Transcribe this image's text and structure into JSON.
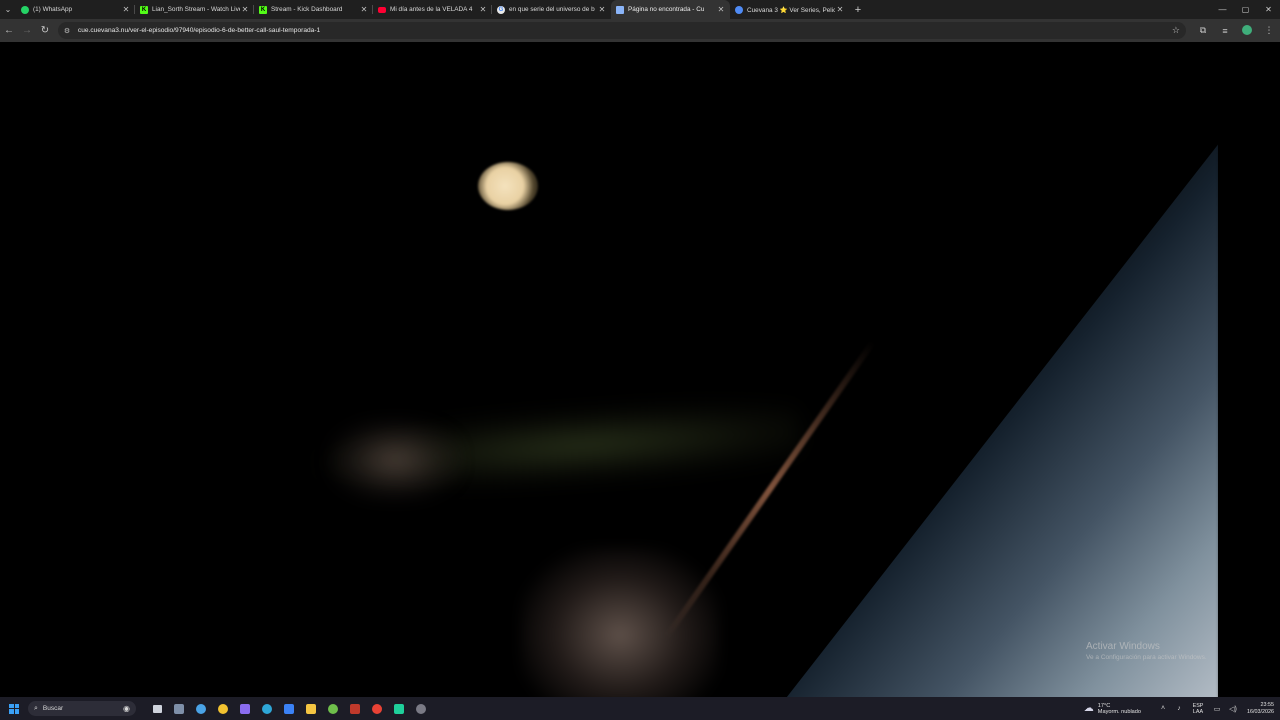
{
  "browser": {
    "tabs": [
      {
        "title": "(1) WhatsApp",
        "icon": "whatsapp-icon",
        "color": "#25d366",
        "active": false
      },
      {
        "title": "Lian_Sorth Stream - Watch Live",
        "icon": "kick-icon",
        "color": "#53fc18",
        "active": false
      },
      {
        "title": "Stream - Kick Dashboard",
        "icon": "kick-icon",
        "color": "#53fc18",
        "active": false
      },
      {
        "title": "Mi día antes de la VELADA 4",
        "icon": "youtube-icon",
        "color": "#ff0033",
        "active": false
      },
      {
        "title": "en que serie del universo de b",
        "icon": "google-icon",
        "color": "#e8e8e8",
        "active": false
      },
      {
        "title": "Página no encontrada - Cu",
        "icon": "page-icon",
        "color": "#8ab4f8",
        "active": true
      },
      {
        "title": "Cuevana 3 ⭐ Ver Series, Pelicu",
        "icon": "cuevana-icon",
        "color": "#4f8bf5",
        "active": false
      }
    ],
    "url": "cue.cuevana3.nu/ver-el-episodio/97940/episodio-6-de-better-call-saul-temporada-1"
  },
  "watermark": {
    "title": "Activar Windows",
    "subtitle": "Ve a Configuración para activar Windows."
  },
  "taskbar": {
    "search_label": "Buscar",
    "weather_temp": "17°C",
    "weather_desc": "Mayorm. nublado",
    "lang_line1": "ESP",
    "lang_line2": "LAA",
    "time": "23:55",
    "date": "16/03/2026"
  }
}
